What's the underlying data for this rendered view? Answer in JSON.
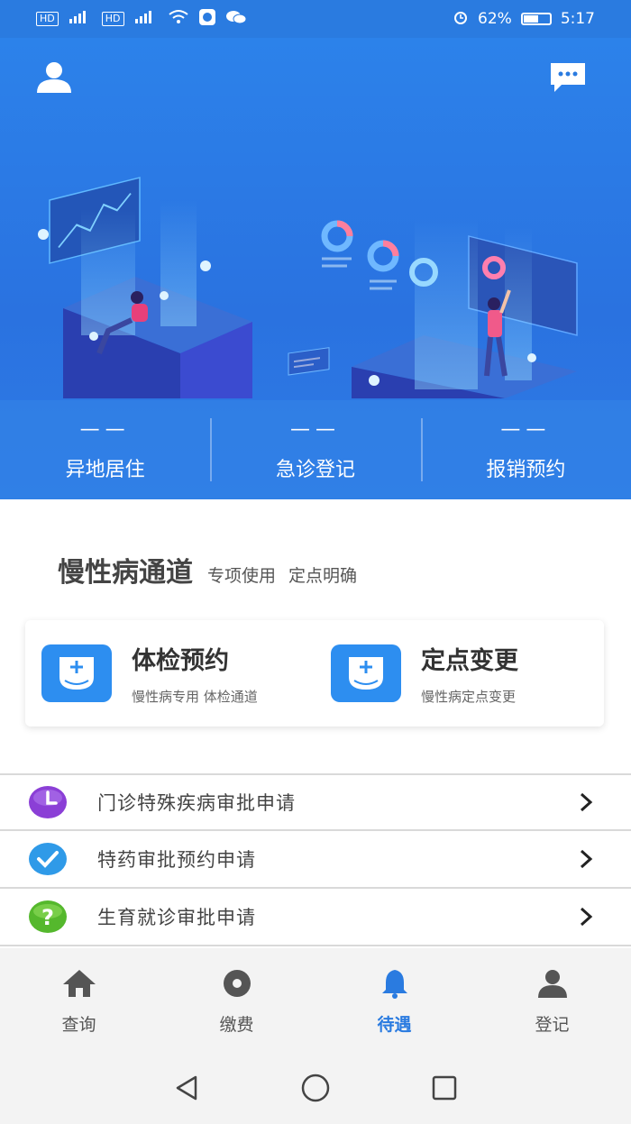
{
  "status_bar": {
    "network_chip_1": "HD",
    "network_chip_2": "HD",
    "battery": "62%",
    "battery_level": 0.62,
    "time": "5:17"
  },
  "hero": {
    "quick_links": [
      {
        "value": "——",
        "label": "异地居住"
      },
      {
        "value": "——",
        "label": "急诊登记"
      },
      {
        "value": "——",
        "label": "报销预约"
      }
    ]
  },
  "section": {
    "title": "慢性病通道",
    "subtitle": "专项使用  定点明确"
  },
  "cards": [
    {
      "title": "体检预约",
      "desc": "慢性病专用  体检通道"
    },
    {
      "title": "定点变更",
      "desc": "慢性病定点变更"
    }
  ],
  "list": [
    {
      "label": "门诊特殊疾病审批申请",
      "icon": "clock-icon",
      "color": "#8b3fd6"
    },
    {
      "label": "特药审批预约申请",
      "icon": "check-icon",
      "color": "#2f9ae8"
    },
    {
      "label": "生育就诊审批申请",
      "icon": "question-icon",
      "color": "#55b82d"
    }
  ],
  "bottom_nav": [
    {
      "label": "查询",
      "icon": "home-icon",
      "active": false
    },
    {
      "label": "缴费",
      "icon": "disc-icon",
      "active": false
    },
    {
      "label": "待遇",
      "icon": "bell-icon",
      "active": true
    },
    {
      "label": "登记",
      "icon": "user-icon",
      "active": false
    }
  ],
  "colors": {
    "primary": "#2a7be0",
    "card_icon": "#2d8ef0"
  }
}
